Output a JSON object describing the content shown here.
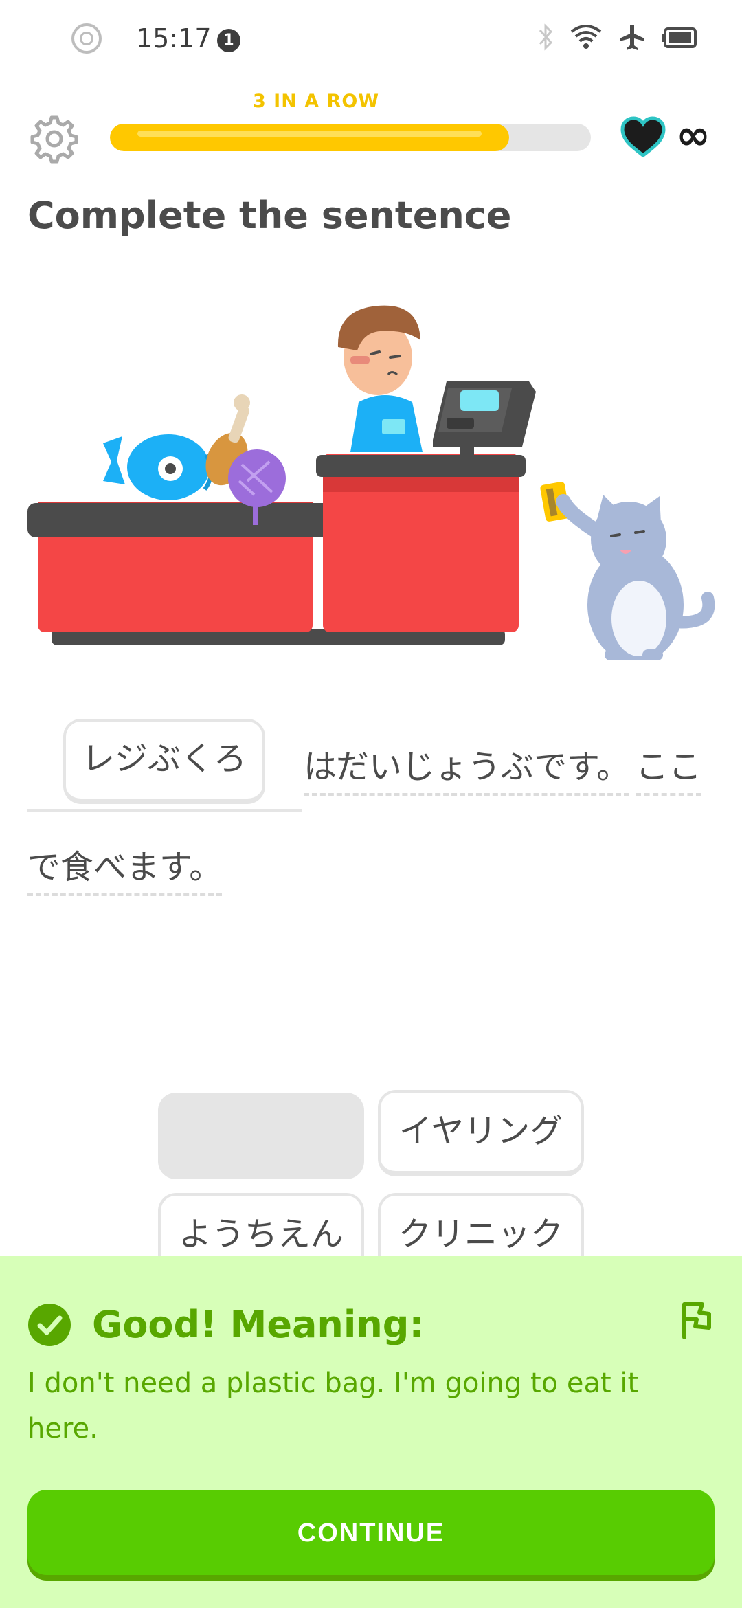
{
  "status_bar": {
    "time": "15:17",
    "notification_count": "1",
    "icons": [
      "circle-icon",
      "bluetooth-icon",
      "wifi-icon",
      "airplane-icon",
      "battery-icon"
    ]
  },
  "header": {
    "streak_label": "3 IN A ROW",
    "progress_fraction": 0.83,
    "hearts": "∞"
  },
  "title": "Complete the sentence",
  "sentence": {
    "answer": "レジぶくろ",
    "part1": "はだいじょうぶです。",
    "part2": "ここ",
    "part3": "で食べます。"
  },
  "word_bank": {
    "chips": [
      "イヤリング",
      "ようちえん",
      "クリニック"
    ]
  },
  "feedback": {
    "title": "Good! Meaning:",
    "text": "I don't need a plastic bag. I'm going to eat it here.",
    "continue_label": "CONTINUE"
  },
  "colors": {
    "accent_green": "#58cc02",
    "feedback_bg": "#d7ffb8",
    "feedback_text": "#58a700",
    "streak": "#ffc800"
  }
}
